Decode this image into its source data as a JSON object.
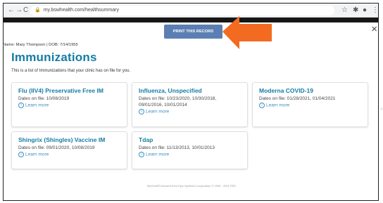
{
  "browser": {
    "back_icon": "←",
    "forward_icon": "→",
    "reload_icon": "C",
    "lock_icon": "🔒",
    "url": "my.bswhealth.com/healthsummary",
    "star_icon": "☆",
    "puzzle_icon": "✱",
    "menu_icon": "⋮",
    "profile_icon": "●"
  },
  "modal": {
    "close_label": "×",
    "print_label": "PRINT THIS RECORD",
    "patient_line": "Name: Mary Thompson | DOB: 7/14/1955",
    "title": "Immunizations",
    "intro": "This is a list of Immunizations that your clinic has on file for you.",
    "arrow_color": "#f26b21"
  },
  "cards": [
    {
      "name": "Flu (IIV4) Preservative Free IM",
      "dates": "Dates on file: 10/08/2019",
      "learn": "Learn more"
    },
    {
      "name": "Influenza, Unspecified",
      "dates": "Dates on file: 10/23/2020, 10/30/2018, 09/01/2016, 10/01/2014",
      "learn": "Learn more"
    },
    {
      "name": "Moderna COVID-19",
      "dates": "Dates on file: 01/28/2021, 01/04/2021",
      "learn": "Learn more"
    },
    {
      "name": "Shingrix (Shingles) Vaccine IM",
      "dates": "Dates on file: 09/01/2020, 10/08/2019",
      "learn": "Learn more"
    },
    {
      "name": "Tdap",
      "dates": "Dates on file: 11/13/2013, 10/01/2013",
      "learn": "Learn more"
    }
  ],
  "footer": "MyChart® licensed from Epic Systems Corporation © 1999 - 2021 R0D"
}
